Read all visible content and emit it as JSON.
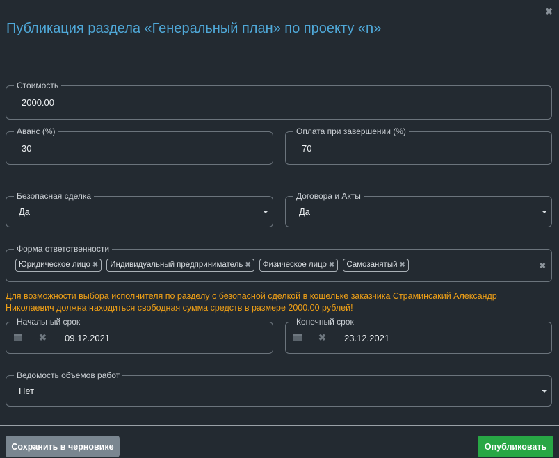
{
  "dialog": {
    "title": "Публикация раздела «Генеральный план» по проекту «n»",
    "close_glyph": "✖"
  },
  "fields": {
    "cost": {
      "label": "Стоимость",
      "value": "2000.00"
    },
    "advance": {
      "label": "Аванс (%)",
      "value": "30"
    },
    "completion": {
      "label": "Оплата при завершении (%)",
      "value": "70"
    },
    "safe_deal": {
      "label": "Безопасная сделка",
      "value": "Да"
    },
    "contracts": {
      "label": "Договора и Акты",
      "value": "Да"
    },
    "responsibility": {
      "label": "Форма ответственности",
      "tags": [
        "Юридическое лицо",
        "Индивидуальный предприниматель",
        "Физическое лицо",
        "Самозанятый"
      ],
      "tag_remove_glyph": "✖",
      "clear_glyph": "✖"
    },
    "start_date": {
      "label": "Начальный срок",
      "value": "09.12.2021",
      "clear_glyph": "✖"
    },
    "end_date": {
      "label": "Конечный срок",
      "value": "23.12.2021",
      "clear_glyph": "✖"
    },
    "work_statement": {
      "label": "Ведомость объемов работ",
      "value": "Нет"
    }
  },
  "warning": "Для возможности выбора исполнителя по разделу с безопасной сделкой в кошельке заказчика Страминсакий Александр Николаевич должна находиться свободная сумма средств в размере 2000.00 рублей!",
  "buttons": {
    "save_draft": "Сохранить в черновике",
    "publish": "Опубликовать"
  },
  "colors": {
    "background": "#232a31",
    "title": "#4fa8d8",
    "warning": "#f0a016",
    "publish": "#28a745",
    "draft": "#7a8690"
  },
  "icons": {
    "calendar": "calendar-icon",
    "close": "close-icon",
    "caret": "chevron-down-icon"
  }
}
